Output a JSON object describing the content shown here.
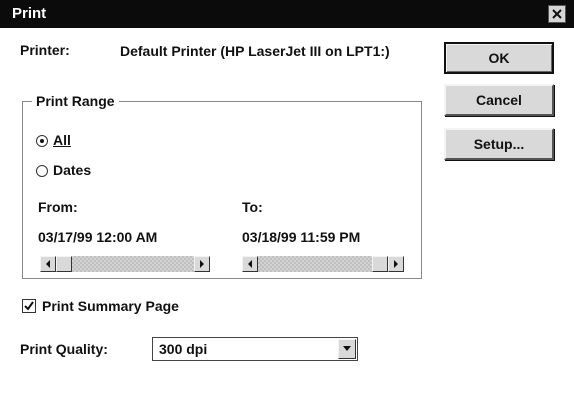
{
  "window": {
    "title": "Print",
    "close_icon": "close-icon"
  },
  "printer": {
    "label": "Printer:",
    "name": "Default Printer (HP LaserJet III on LPT1:)"
  },
  "buttons": {
    "ok": "OK",
    "cancel": "Cancel",
    "setup": "Setup..."
  },
  "print_range": {
    "legend": "Print Range",
    "options": [
      {
        "label": "All",
        "selected": true
      },
      {
        "label": "Dates",
        "selected": false
      }
    ],
    "from_label": "From:",
    "to_label": "To:",
    "from_value": "03/17/99 12:00 AM",
    "to_value": "03/18/99 11:59 PM"
  },
  "summary": {
    "label": "Print Summary Page",
    "checked": true
  },
  "quality": {
    "label": "Print Quality:",
    "value": "300 dpi"
  },
  "colors": {
    "titlebar": "#0b0b0b",
    "button_face": "#d9d9d9",
    "background": "#ffffff"
  }
}
